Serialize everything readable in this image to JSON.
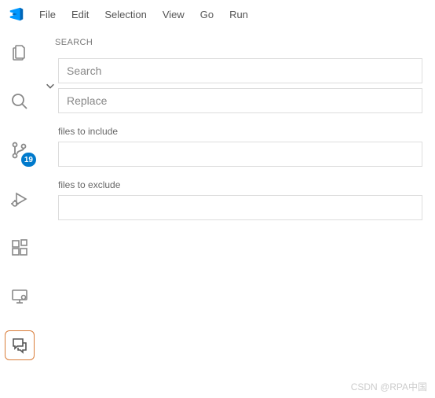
{
  "menu": {
    "items": [
      "File",
      "Edit",
      "Selection",
      "View",
      "Go",
      "Run"
    ]
  },
  "activity": {
    "source_control_badge": "19"
  },
  "search_panel": {
    "title": "SEARCH",
    "search_placeholder": "Search",
    "replace_placeholder": "Replace",
    "include_label": "files to include",
    "exclude_label": "files to exclude"
  },
  "watermark": "CSDN @RPA中国"
}
